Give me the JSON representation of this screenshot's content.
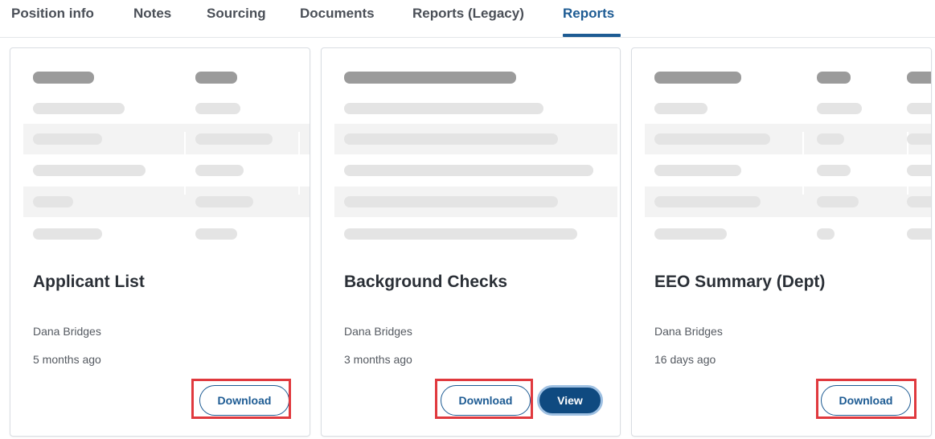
{
  "tabs": {
    "items": [
      {
        "label": "Position info"
      },
      {
        "label": "Notes"
      },
      {
        "label": "Sourcing"
      },
      {
        "label": "Documents"
      },
      {
        "label": "Reports (Legacy)"
      },
      {
        "label": "Reports"
      }
    ],
    "active": "Reports"
  },
  "cards": [
    {
      "title": "Applicant List",
      "author": "Dana Bridges",
      "date": "5 months ago",
      "download_label": "Download"
    },
    {
      "title": "Background Checks",
      "author": "Dana Bridges",
      "date": "3 months ago",
      "download_label": "Download",
      "view_label": "View"
    },
    {
      "title": "EEO Summary (Dept)",
      "author": "Dana Bridges",
      "date": "16 days ago",
      "download_label": "Download"
    }
  ],
  "colors": {
    "accent": "#1d5b93",
    "view_button": "#0f4a80",
    "highlight": "#e0393e"
  }
}
